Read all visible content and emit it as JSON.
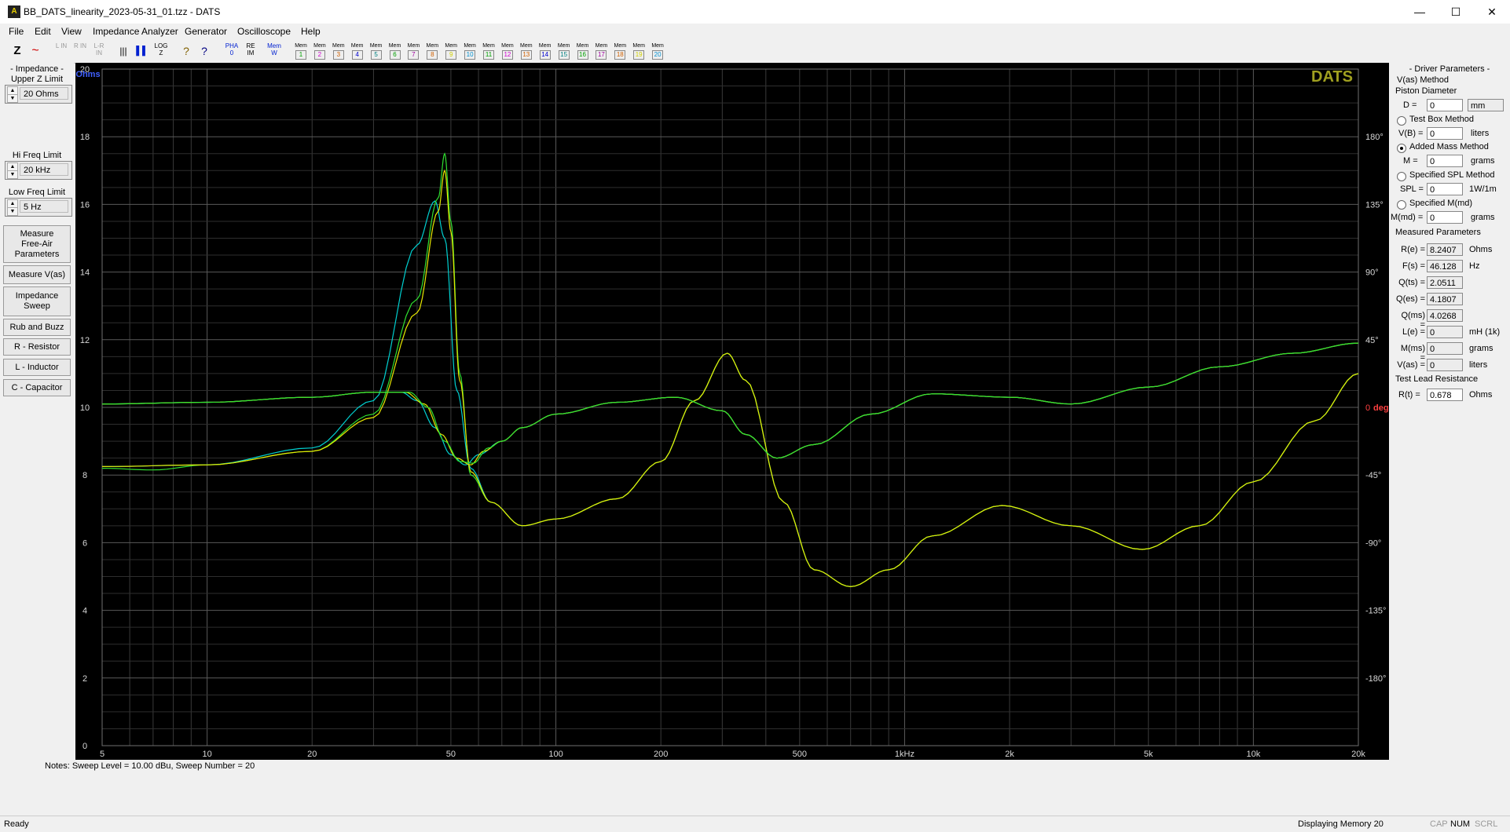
{
  "window": {
    "title": "BB_DATS_linearity_2023-05-31_01.tzz - DATS",
    "min": "—",
    "max": "☐",
    "close": "✕"
  },
  "menu": [
    "File",
    "Edit",
    "View",
    "Impedance Analyzer",
    "Generator",
    "Oscilloscope",
    "Help"
  ],
  "toolbar": {
    "buttons": [
      "Z",
      "~",
      "L IN",
      "R IN",
      "L-R IN",
      "|||",
      "▌▌",
      "LOG Z",
      "?",
      "?",
      "PHA 0",
      "RE IM",
      "Mem W"
    ],
    "memories": [
      "1",
      "2",
      "3",
      "4",
      "5",
      "6",
      "7",
      "8",
      "9",
      "10",
      "11",
      "12",
      "13",
      "14",
      "15",
      "16",
      "17",
      "18",
      "19",
      "20"
    ],
    "mem_label": "Mem",
    "colors": [
      "#00a000",
      "#d000d0",
      "#d06000",
      "#0000d0",
      "#008080",
      "#00a000",
      "#a000a0",
      "#d06000",
      "#d0d000",
      "#0090d0",
      "#00a000",
      "#d000d0",
      "#d06000",
      "#0000d0",
      "#008080",
      "#00a000",
      "#a000a0",
      "#d06000",
      "#d0d000",
      "#0090d0"
    ]
  },
  "left": {
    "impedance_title": "- Impedance -",
    "upper_z_label": "Upper Z Limit",
    "upper_z_value": "20 Ohms",
    "hi_freq_label": "Hi Freq Limit",
    "hi_freq_value": "20 kHz",
    "low_freq_label": "Low Freq Limit",
    "low_freq_value": "5 Hz",
    "buttons": [
      "Measure\nFree-Air\nParameters",
      "Measure V(as)",
      "Impedance\nSweep",
      "Rub and Buzz",
      "R - Resistor",
      "L - Inductor",
      "C - Capacitor"
    ]
  },
  "chart_data": {
    "type": "line",
    "watermark": "DATS",
    "ylabel_left": "Ohms",
    "ylabel_right": "deg",
    "x_scale": "log",
    "xlim": [
      5,
      20000
    ],
    "ylim_left": [
      0,
      20
    ],
    "ylim_right": [
      -225,
      225
    ],
    "grid": true,
    "x_ticks": [
      {
        "v": 5,
        "label": "5"
      },
      {
        "v": 10,
        "label": "10"
      },
      {
        "v": 20,
        "label": "20"
      },
      {
        "v": 50,
        "label": "50"
      },
      {
        "v": 100,
        "label": "100"
      },
      {
        "v": 200,
        "label": "200"
      },
      {
        "v": 500,
        "label": "500"
      },
      {
        "v": 1000,
        "label": "1kHz"
      },
      {
        "v": 2000,
        "label": "2k"
      },
      {
        "v": 5000,
        "label": "5k"
      },
      {
        "v": 10000,
        "label": "10k"
      },
      {
        "v": 20000,
        "label": "20k"
      }
    ],
    "y_ticks_left": [
      0,
      2,
      4,
      6,
      8,
      10,
      12,
      14,
      16,
      18,
      20
    ],
    "y_ticks_right": [
      {
        "v": 180,
        "label": "180°"
      },
      {
        "v": 135,
        "label": "135°"
      },
      {
        "v": 90,
        "label": "90°"
      },
      {
        "v": 45,
        "label": "45°"
      },
      {
        "v": 0,
        "label": "0"
      },
      {
        "v": -45,
        "label": "-45°"
      },
      {
        "v": -90,
        "label": "-90°"
      },
      {
        "v": -135,
        "label": "-135°"
      },
      {
        "v": -180,
        "label": "-180°"
      }
    ],
    "series": [
      {
        "color": "#00d0d0",
        "axis": "left",
        "points": [
          [
            5,
            8.25
          ],
          [
            10,
            8.3
          ],
          [
            20,
            8.8
          ],
          [
            30,
            10.2
          ],
          [
            40,
            14.8
          ],
          [
            45,
            16.1
          ],
          [
            48,
            15.0
          ],
          [
            52,
            10.5
          ],
          [
            57,
            8.2
          ],
          [
            65,
            7.2
          ],
          [
            80,
            6.5
          ],
          [
            100,
            6.7
          ],
          [
            150,
            7.3
          ],
          [
            200,
            8.4
          ],
          [
            250,
            10.2
          ],
          [
            310,
            11.6
          ],
          [
            350,
            10.8
          ],
          [
            450,
            7.2
          ],
          [
            550,
            5.2
          ],
          [
            700,
            4.7
          ],
          [
            900,
            5.2
          ],
          [
            1200,
            6.2
          ],
          [
            1900,
            7.1
          ],
          [
            3000,
            6.5
          ],
          [
            4800,
            5.8
          ],
          [
            7000,
            6.5
          ],
          [
            10000,
            7.8
          ],
          [
            15000,
            9.6
          ],
          [
            20000,
            11.0
          ]
        ]
      },
      {
        "color": "#30e030",
        "axis": "left",
        "points": [
          [
            5,
            8.2
          ],
          [
            7,
            8.15
          ],
          [
            10,
            8.3
          ],
          [
            20,
            8.7
          ],
          [
            30,
            9.8
          ],
          [
            40,
            13.2
          ],
          [
            46,
            16.2
          ],
          [
            48,
            17.5
          ],
          [
            50,
            15.5
          ],
          [
            53,
            11.0
          ],
          [
            57,
            8.0
          ],
          [
            65,
            7.2
          ],
          [
            80,
            6.5
          ],
          [
            100,
            6.7
          ],
          [
            150,
            7.3
          ],
          [
            200,
            8.4
          ],
          [
            250,
            10.2
          ],
          [
            310,
            11.6
          ],
          [
            350,
            10.8
          ],
          [
            450,
            7.2
          ],
          [
            550,
            5.2
          ],
          [
            700,
            4.7
          ],
          [
            900,
            5.2
          ],
          [
            1200,
            6.2
          ],
          [
            1900,
            7.1
          ],
          [
            3000,
            6.5
          ],
          [
            4800,
            5.8
          ],
          [
            7000,
            6.5
          ],
          [
            10000,
            7.8
          ],
          [
            15000,
            9.6
          ],
          [
            20000,
            11.0
          ]
        ]
      },
      {
        "color": "#e8e800",
        "axis": "left",
        "points": [
          [
            5,
            8.25
          ],
          [
            10,
            8.3
          ],
          [
            20,
            8.7
          ],
          [
            30,
            9.7
          ],
          [
            40,
            12.8
          ],
          [
            46,
            15.8
          ],
          [
            48,
            17.0
          ],
          [
            50,
            15.2
          ],
          [
            53,
            10.8
          ],
          [
            57,
            8.1
          ],
          [
            65,
            7.2
          ],
          [
            80,
            6.5
          ],
          [
            100,
            6.7
          ],
          [
            150,
            7.3
          ],
          [
            200,
            8.4
          ],
          [
            250,
            10.2
          ],
          [
            310,
            11.6
          ],
          [
            350,
            10.8
          ],
          [
            450,
            7.2
          ],
          [
            550,
            5.2
          ],
          [
            700,
            4.7
          ],
          [
            900,
            5.2
          ],
          [
            1200,
            6.2
          ],
          [
            1900,
            7.1
          ],
          [
            3000,
            6.5
          ],
          [
            4800,
            5.8
          ],
          [
            7000,
            6.5
          ],
          [
            10000,
            7.8
          ],
          [
            15000,
            9.6
          ],
          [
            20000,
            11.0
          ]
        ]
      },
      {
        "color": "#00d0d0",
        "axis": "left",
        "points": [
          [
            5,
            10.1
          ],
          [
            10,
            10.15
          ],
          [
            20,
            10.3
          ],
          [
            30,
            10.45
          ],
          [
            36,
            10.45
          ],
          [
            40,
            10.2
          ],
          [
            45,
            9.4
          ],
          [
            50,
            8.6
          ],
          [
            55,
            8.3
          ],
          [
            60,
            8.6
          ],
          [
            70,
            9.0
          ],
          [
            80,
            9.4
          ],
          [
            100,
            9.8
          ],
          [
            150,
            10.15
          ],
          [
            220,
            10.3
          ],
          [
            300,
            9.9
          ],
          [
            350,
            9.2
          ],
          [
            430,
            8.5
          ],
          [
            550,
            8.9
          ],
          [
            800,
            9.8
          ],
          [
            1200,
            10.4
          ],
          [
            2000,
            10.3
          ],
          [
            3000,
            10.1
          ],
          [
            5000,
            10.6
          ],
          [
            8000,
            11.2
          ],
          [
            13000,
            11.6
          ],
          [
            20000,
            11.9
          ]
        ]
      },
      {
        "color": "#e8e800",
        "axis": "left",
        "points": [
          [
            5,
            10.1
          ],
          [
            10,
            10.15
          ],
          [
            20,
            10.3
          ],
          [
            30,
            10.45
          ],
          [
            37,
            10.45
          ],
          [
            42,
            10.1
          ],
          [
            47,
            9.2
          ],
          [
            52,
            8.5
          ],
          [
            57,
            8.3
          ],
          [
            62,
            8.7
          ],
          [
            70,
            9.0
          ],
          [
            80,
            9.4
          ],
          [
            100,
            9.8
          ],
          [
            150,
            10.15
          ],
          [
            220,
            10.3
          ],
          [
            300,
            9.9
          ],
          [
            350,
            9.2
          ],
          [
            430,
            8.5
          ],
          [
            550,
            8.9
          ],
          [
            800,
            9.8
          ],
          [
            1200,
            10.4
          ],
          [
            2000,
            10.3
          ],
          [
            3000,
            10.1
          ],
          [
            5000,
            10.6
          ],
          [
            8000,
            11.2
          ],
          [
            13000,
            11.6
          ],
          [
            20000,
            11.9
          ]
        ]
      },
      {
        "color": "#30e030",
        "axis": "left",
        "points": [
          [
            5,
            10.1
          ],
          [
            10,
            10.15
          ],
          [
            20,
            10.3
          ],
          [
            30,
            10.45
          ],
          [
            38,
            10.45
          ],
          [
            43,
            10.0
          ],
          [
            48,
            9.0
          ],
          [
            53,
            8.4
          ],
          [
            58,
            8.35
          ],
          [
            64,
            8.8
          ],
          [
            70,
            9.0
          ],
          [
            80,
            9.4
          ],
          [
            100,
            9.8
          ],
          [
            150,
            10.15
          ],
          [
            220,
            10.3
          ],
          [
            300,
            9.9
          ],
          [
            350,
            9.2
          ],
          [
            430,
            8.5
          ],
          [
            550,
            8.9
          ],
          [
            800,
            9.8
          ],
          [
            1200,
            10.4
          ],
          [
            2000,
            10.3
          ],
          [
            3000,
            10.1
          ],
          [
            5000,
            10.6
          ],
          [
            8000,
            11.2
          ],
          [
            13000,
            11.6
          ],
          [
            20000,
            11.9
          ]
        ]
      }
    ]
  },
  "right": {
    "title": "- Driver Parameters -",
    "vas_method": "V(as) Method",
    "piston_diameter": "Piston Diameter",
    "d_label": "D =",
    "d_value": "0",
    "d_unit": "mm",
    "test_box": "Test Box Method",
    "vb_label": "V(B) =",
    "vb_value": "0",
    "vb_unit": "liters",
    "added_mass": "Added Mass Method",
    "m_label": "M =",
    "m_value": "0",
    "m_unit": "grams",
    "spec_spl": "Specified SPL Method",
    "spl_label": "SPL =",
    "spl_value": "0",
    "spl_unit": "1W/1m",
    "spec_mmd": "Specified M(md)",
    "mmd_label": "M(md) =",
    "mmd_value": "0",
    "mmd_unit": "grams",
    "measured_title": "Measured Parameters",
    "params": [
      {
        "label": "R(e) =",
        "value": "8.2407",
        "unit": "Ohms"
      },
      {
        "label": "F(s) =",
        "value": "46.128",
        "unit": "Hz"
      },
      {
        "label": "Q(ts) =",
        "value": "2.0511",
        "unit": ""
      },
      {
        "label": "Q(es) =",
        "value": "4.1807",
        "unit": ""
      },
      {
        "label": "Q(ms) =",
        "value": "4.0268",
        "unit": ""
      },
      {
        "label": "L(e) =",
        "value": "0",
        "unit": "mH (1k)"
      },
      {
        "label": "M(ms) =",
        "value": "0",
        "unit": "grams"
      },
      {
        "label": "V(as) =",
        "value": "0",
        "unit": "liters"
      }
    ],
    "lead_title": "Test Lead Resistance",
    "rt_label": "R(t) =",
    "rt_value": "0.678",
    "rt_unit": "Ohms"
  },
  "notes": "Notes:  Sweep Level = 10.00 dBu,   Sweep Number =    20",
  "status": {
    "left": "Ready",
    "right": "Displaying Memory 20",
    "cap": "CAP",
    "num": "NUM",
    "scrl": "SCRL"
  }
}
